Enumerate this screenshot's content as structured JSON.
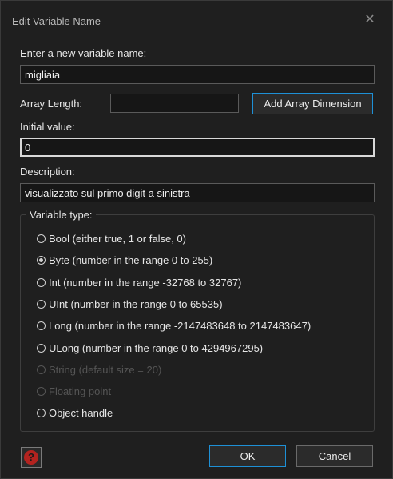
{
  "window": {
    "title": "Edit Variable Name",
    "close_glyph": "✕"
  },
  "name_section": {
    "label": "Enter a new variable name:",
    "value": "migliaia"
  },
  "array": {
    "label": "Array Length:",
    "value": "",
    "add_button_label": "Add Array Dimension"
  },
  "initial": {
    "label": "Initial value:",
    "value": "0"
  },
  "description": {
    "label": "Description:",
    "value": "visualizzato sul primo digit a sinistra"
  },
  "variable_type": {
    "legend": "Variable type:",
    "options": [
      {
        "label": "Bool (either true, 1 or false, 0)",
        "checked": false,
        "enabled": true
      },
      {
        "label": "Byte (number in the range 0 to 255)",
        "checked": true,
        "enabled": true
      },
      {
        "label": "Int (number in the range -32768 to 32767)",
        "checked": false,
        "enabled": true
      },
      {
        "label": "UInt (number in the range 0 to 65535)",
        "checked": false,
        "enabled": true
      },
      {
        "label": "Long (number in the range -2147483648 to 2147483647)",
        "checked": false,
        "enabled": true
      },
      {
        "label": "ULong (number in the range 0 to 4294967295)",
        "checked": false,
        "enabled": true
      },
      {
        "label": "String (default size = 20)",
        "checked": false,
        "enabled": false
      },
      {
        "label": "Floating point",
        "checked": false,
        "enabled": false
      },
      {
        "label": "Object handle",
        "checked": false,
        "enabled": true
      }
    ]
  },
  "footer": {
    "help_glyph": "?",
    "ok_label": "OK",
    "cancel_label": "Cancel"
  },
  "colors": {
    "background": "#1f1f1f",
    "accent_border": "#1e90d6",
    "help_icon": "#b3231f",
    "disabled_text": "#555555"
  }
}
